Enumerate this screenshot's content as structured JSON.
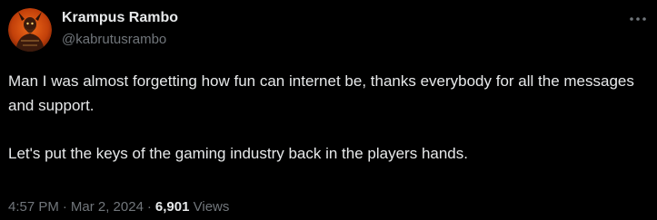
{
  "author": {
    "display_name": "Krampus Rambo",
    "handle": "@kabrutusrambo",
    "avatar_icon": "demon-avatar-icon"
  },
  "post": {
    "paragraphs": [
      "Man I was almost forgetting how fun can internet be, thanks everybody for all the messages and support.",
      "Let's put the keys of the gaming industry back in the players hands."
    ]
  },
  "meta": {
    "time": "4:57 PM",
    "separator": "·",
    "date": "Mar 2, 2024",
    "views_count": "6,901",
    "views_label": "Views"
  },
  "icons": {
    "more": "more-options-icon"
  },
  "colors": {
    "background": "#000000",
    "primary_text": "#e7e9ea",
    "secondary_text": "#71767b",
    "avatar_bg": "#c2400a"
  }
}
